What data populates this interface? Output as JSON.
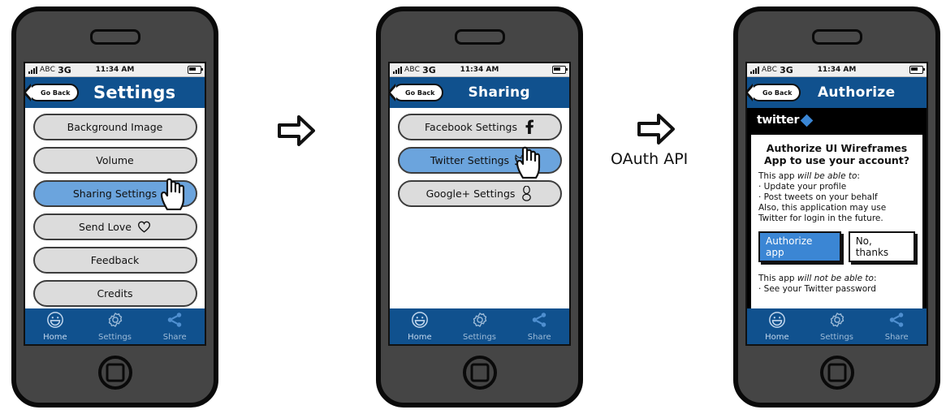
{
  "meta": {
    "diagram_title": "OAuth sharing flow wireframe",
    "colors": {
      "nav_blue": "#10518e",
      "selected_blue": "#6ba4dd",
      "twitter_blue": "#3b86d4",
      "pill_gray": "#dcdcdc",
      "phone_body": "#454545"
    }
  },
  "status_bar": {
    "carrier": "ABC",
    "network": "3G",
    "time": "11:34 AM",
    "signal_icon": "signal-bars-icon",
    "battery_icon": "battery-icon"
  },
  "tab_bar": {
    "items": [
      {
        "label": "Home",
        "icon": "smiley-face-icon",
        "active": true
      },
      {
        "label": "Settings",
        "icon": "gear-icon",
        "active": false
      },
      {
        "label": "Share",
        "icon": "share-nodes-icon",
        "active": false
      }
    ]
  },
  "back_button_label": "Go Back",
  "screens": [
    {
      "id": "settings",
      "title": "Settings",
      "items": [
        {
          "label": "Background Image",
          "selected": false,
          "glyph": ""
        },
        {
          "label": "Volume",
          "selected": false,
          "glyph": ""
        },
        {
          "label": "Sharing Settings",
          "selected": true,
          "glyph": ""
        },
        {
          "label": "Send Love",
          "selected": false,
          "glyph": "heart-icon"
        },
        {
          "label": "Feedback",
          "selected": false,
          "glyph": ""
        },
        {
          "label": "Credits",
          "selected": false,
          "glyph": ""
        }
      ],
      "cursor_on_item": 2
    },
    {
      "id": "sharing",
      "title": "Sharing",
      "items": [
        {
          "label": "Facebook Settings",
          "selected": false,
          "glyph": "facebook-icon"
        },
        {
          "label": "Twitter Settings",
          "selected": true,
          "glyph": "twitter-bird-icon"
        },
        {
          "label": "Google+ Settings",
          "selected": false,
          "glyph": "googleplus-icon"
        }
      ],
      "cursor_on_item": 1
    },
    {
      "id": "authorize",
      "title": "Authorize",
      "brand": {
        "wordmark": "twitter",
        "diamond_icon": "twitter-diamond-icon"
      },
      "dialog": {
        "heading_line1": "Authorize UI Wireframes",
        "heading_line2": "App to use your account?",
        "able_intro_plain": "This app ",
        "able_intro_em": "will be able to",
        "able_intro_colon": ":",
        "able_items": [
          "· Update your profile",
          "· Post tweets on your behalf"
        ],
        "also_text": "Also, this application may use Twitter for login in the future.",
        "buttons": [
          {
            "label": "Authorize app",
            "primary": true
          },
          {
            "label": "No, thanks",
            "primary": false
          }
        ],
        "notable_intro_plain": "This app ",
        "notable_intro_em": "will not be able to",
        "notable_intro_colon": ":",
        "notable_items": [
          "· See your Twitter password"
        ]
      }
    }
  ],
  "connectors": [
    {
      "id": "arrow1",
      "icon": "right-arrow-icon",
      "label": ""
    },
    {
      "id": "arrow2",
      "icon": "right-arrow-icon",
      "label": "OAuth API"
    }
  ]
}
